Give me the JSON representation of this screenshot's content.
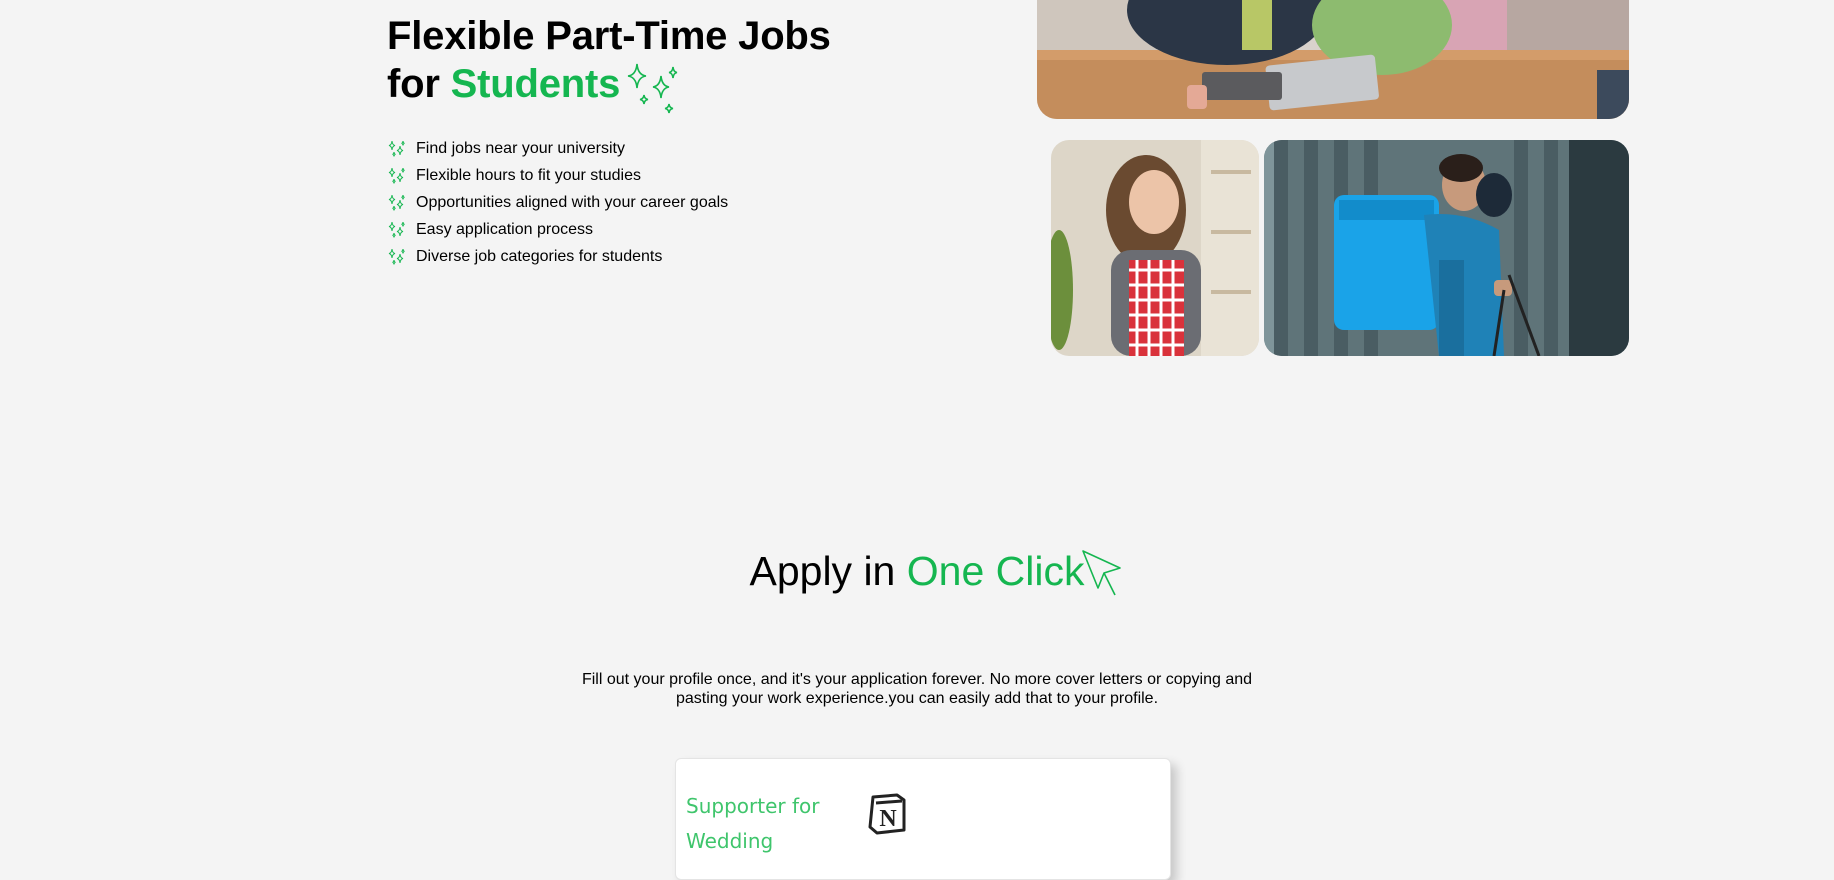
{
  "hero": {
    "title_line1": "Flexible Part-Time Jobs",
    "title_for": "for",
    "title_highlight": "Students",
    "sparkle_icon": "sparkles-icon",
    "accent_color": "#15b650",
    "features": [
      "Find jobs near your university",
      "Flexible hours to fit your studies",
      "Opportunities aligned with your career goals",
      "Easy application process",
      "Diverse job categories for students"
    ]
  },
  "photos": [
    {
      "name": "students-meeting-photo"
    },
    {
      "name": "waitress-apron-photo"
    },
    {
      "name": "delivery-courier-photo"
    }
  ],
  "apply": {
    "title_prefix": "Apply in",
    "title_highlight": "One Click",
    "icon": "cursor-arrow-icon",
    "description_line1": "Fill out your profile once, and it's your application forever. No more cover letters or copying and",
    "description_line2": "pasting your work experience.you can easily add that to your profile."
  },
  "job_card": {
    "title_line1": "Supporter for",
    "title_line2": "Wedding",
    "logo": "notion-logo-icon",
    "title_color": "#3fc56c"
  }
}
